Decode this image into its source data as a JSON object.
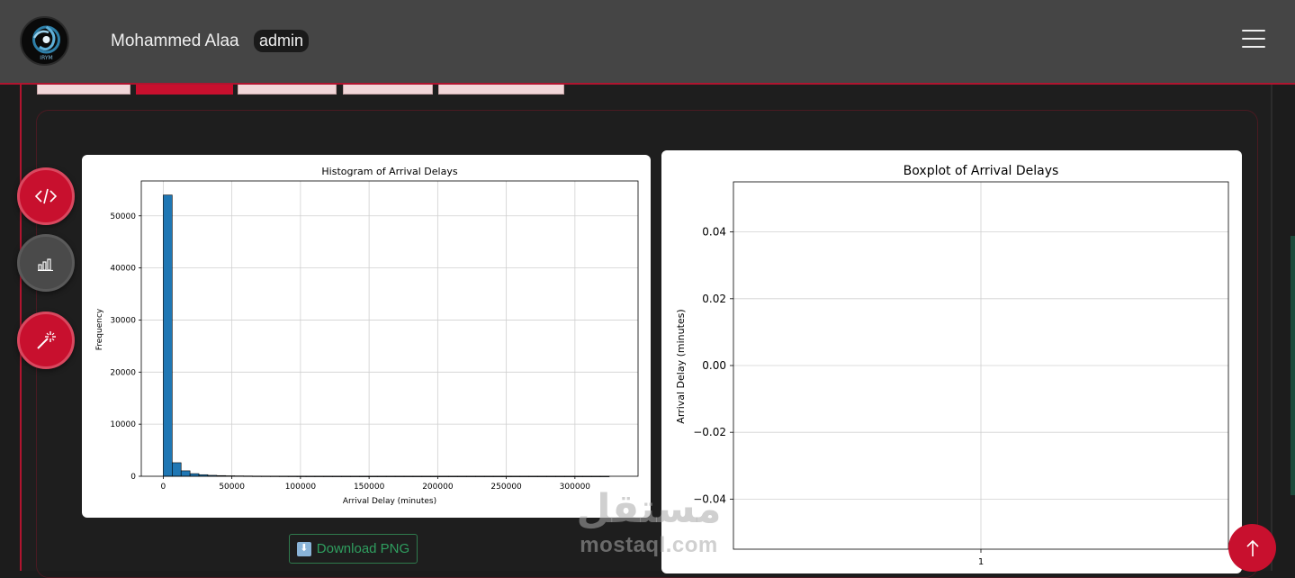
{
  "header": {
    "user_name": "Mohammed Alaa",
    "role_badge": "admin",
    "logo_text": "IRYM"
  },
  "tabs": [
    {
      "label": "",
      "active": false
    },
    {
      "label": "",
      "active": true
    },
    {
      "label": "",
      "active": false
    },
    {
      "label": "",
      "active": false
    },
    {
      "label": "",
      "active": false
    }
  ],
  "side_actions": [
    {
      "icon": "code-icon"
    },
    {
      "icon": "bar-chart-icon"
    },
    {
      "icon": "magic-wand-icon"
    }
  ],
  "download": {
    "label": "Download PNG",
    "icon": "download-icon"
  },
  "watermark": {
    "arabic": "مستقل",
    "latin": "mostaql.com"
  },
  "colors": {
    "accent": "#c8102e",
    "bar": "#1f77b4",
    "topbar": "#454545"
  },
  "chart_data": [
    {
      "type": "bar",
      "title": "Histogram of Arrival Delays",
      "xlabel": "Arrival Delay (minutes)",
      "ylabel": "Frequency",
      "xlim": [
        -16000,
        346000
      ],
      "ylim": [
        0,
        56700
      ],
      "xticks": [
        0,
        50000,
        100000,
        150000,
        200000,
        250000,
        300000
      ],
      "xtick_labels": [
        "0",
        "50000",
        "100000",
        "150000",
        "200000",
        "250000",
        "300000"
      ],
      "yticks": [
        0,
        10000,
        20000,
        30000,
        40000,
        50000
      ],
      "ytick_labels": [
        "0",
        "10000",
        "20000",
        "30000",
        "40000",
        "50000"
      ],
      "bin_width": 6500,
      "bin_start": 0,
      "values": [
        54000,
        2600,
        1050,
        500,
        300,
        180,
        130,
        90,
        70,
        55,
        40,
        35,
        30,
        25,
        18,
        14,
        10,
        8,
        6,
        5,
        4,
        3,
        3,
        2,
        2,
        2,
        1,
        1,
        1,
        1,
        1,
        1,
        1,
        1,
        1,
        1,
        1,
        1,
        1,
        1,
        1,
        1,
        1,
        1,
        1,
        1,
        1,
        1,
        1,
        1
      ],
      "grid": true
    },
    {
      "type": "boxplot",
      "title": "Boxplot of Arrival Delays",
      "xlabel": "",
      "ylabel": "Arrival Delay (minutes)",
      "categories": [
        "1"
      ],
      "ylim": [
        -0.055,
        0.055
      ],
      "yticks": [
        0.04,
        0.02,
        0.0,
        -0.02,
        -0.04
      ],
      "ytick_labels": [
        "0.04",
        "0.02",
        "0.00",
        "−0.02",
        "−0.04"
      ],
      "grid": true
    }
  ]
}
